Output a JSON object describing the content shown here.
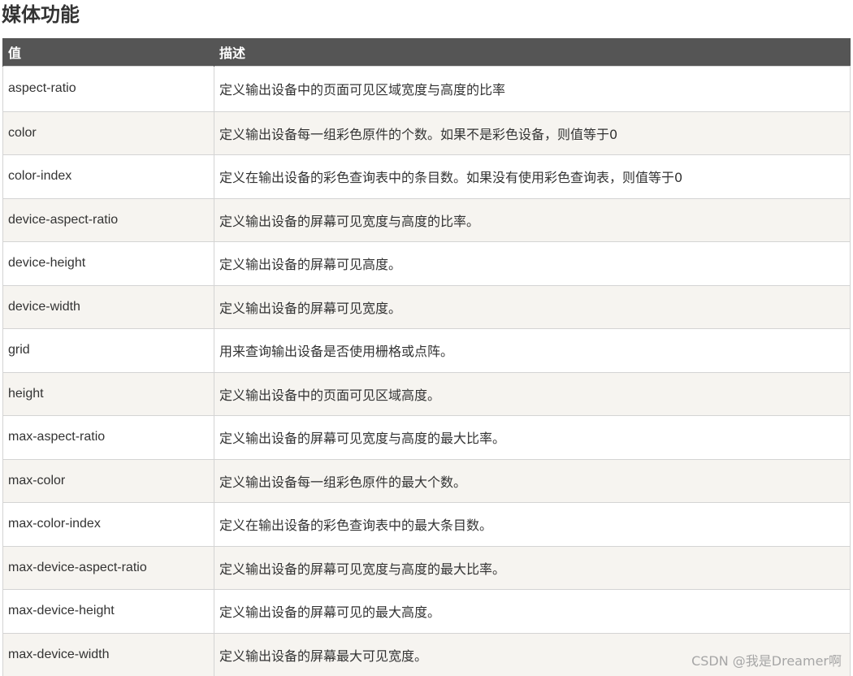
{
  "page": {
    "title": "媒体功能",
    "watermark": "CSDN @我是Dreamer啊"
  },
  "table": {
    "headers": [
      "值",
      "描述"
    ],
    "rows": [
      {
        "value": "aspect-ratio",
        "desc": "定义输出设备中的页面可见区域宽度与高度的比率"
      },
      {
        "value": "color",
        "desc": "定义输出设备每一组彩色原件的个数。如果不是彩色设备，则值等于0"
      },
      {
        "value": "color-index",
        "desc": "定义在输出设备的彩色查询表中的条目数。如果没有使用彩色查询表，则值等于0"
      },
      {
        "value": "device-aspect-ratio",
        "desc": "定义输出设备的屏幕可见宽度与高度的比率。"
      },
      {
        "value": "device-height",
        "desc": "定义输出设备的屏幕可见高度。"
      },
      {
        "value": "device-width",
        "desc": "定义输出设备的屏幕可见宽度。"
      },
      {
        "value": "grid",
        "desc": "用来查询输出设备是否使用栅格或点阵。"
      },
      {
        "value": "height",
        "desc": "定义输出设备中的页面可见区域高度。"
      },
      {
        "value": "max-aspect-ratio",
        "desc": "定义输出设备的屏幕可见宽度与高度的最大比率。"
      },
      {
        "value": "max-color",
        "desc": "定义输出设备每一组彩色原件的最大个数。"
      },
      {
        "value": "max-color-index",
        "desc": "定义在输出设备的彩色查询表中的最大条目数。"
      },
      {
        "value": "max-device-aspect-ratio",
        "desc": "定义输出设备的屏幕可见宽度与高度的最大比率。"
      },
      {
        "value": "max-device-height",
        "desc": "定义输出设备的屏幕可见的最大高度。"
      },
      {
        "value": "max-device-width",
        "desc": "定义输出设备的屏幕最大可见宽度。"
      }
    ]
  }
}
